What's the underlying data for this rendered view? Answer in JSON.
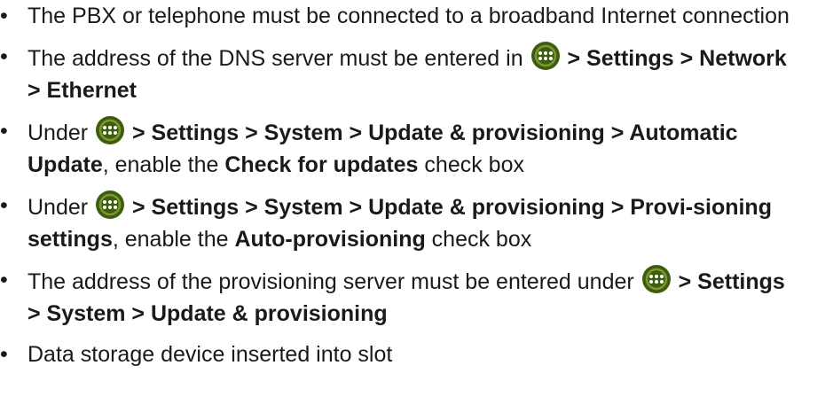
{
  "bullet_glyph": "•",
  "icon": {
    "name": "apps-menu-icon",
    "bg": "#3f5d0f",
    "ring": "#7a9a2e"
  },
  "items": [
    {
      "t1": "The PBX or telephone must be connected to a broadband Internet connection"
    },
    {
      "t1": "The address of the DNS server must be entered in ",
      "b1": " > Settings > Network > Ethernet"
    },
    {
      "t1": "Under ",
      "b1": " > Settings > System > Update & provisioning > Automatic Update",
      "t2": ", enable the ",
      "b2": "Check for updates",
      "t3": " check box"
    },
    {
      "t1": "Under ",
      "b1": " > Settings > System > Update & provisioning > Provi-sioning settings",
      "t2": ", enable the ",
      "b2": "Auto-provisioning",
      "t3": " check box"
    },
    {
      "t1": "The address of the provisioning server must be entered under ",
      "b1": " > Settings > System > Update & provisioning"
    },
    {
      "t1": "Data storage device inserted into slot"
    }
  ]
}
